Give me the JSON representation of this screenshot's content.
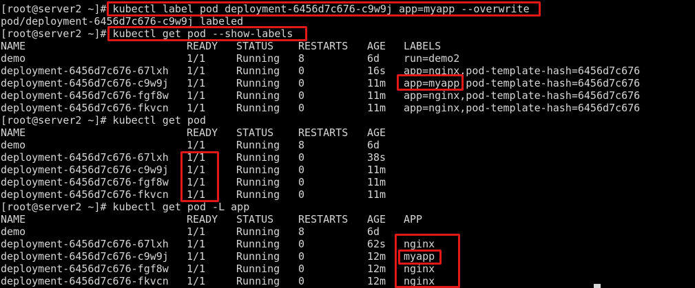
{
  "terminal": {
    "lines": [
      {
        "kind": "text",
        "text": "[root@server2 ~]# kubectl label pod deployment-6456d7c676-c9w9j app=myapp --overwrite"
      },
      {
        "kind": "text",
        "text": "pod/deployment-6456d7c676-c9w9j labeled"
      },
      {
        "kind": "text",
        "text": "[root@server2 ~]# kubectl get pod --show-labels"
      },
      {
        "kind": "row",
        "cells": [
          "NAME",
          "READY",
          "STATUS",
          "RESTARTS",
          "AGE",
          "LABELS"
        ]
      },
      {
        "kind": "row",
        "cells": [
          "demo",
          "1/1",
          "Running",
          "8",
          "6d",
          "run=demo2"
        ]
      },
      {
        "kind": "row",
        "cells": [
          "deployment-6456d7c676-67lxh",
          "1/1",
          "Running",
          "0",
          "16s",
          "app=nginx,pod-template-hash=6456d7c676"
        ]
      },
      {
        "kind": "row",
        "cells": [
          "deployment-6456d7c676-c9w9j",
          "1/1",
          "Running",
          "0",
          "11m",
          "app=myapp,pod-template-hash=6456d7c676"
        ]
      },
      {
        "kind": "row",
        "cells": [
          "deployment-6456d7c676-fgf8w",
          "1/1",
          "Running",
          "0",
          "11m",
          "app=nginx,pod-template-hash=6456d7c676"
        ]
      },
      {
        "kind": "row",
        "cells": [
          "deployment-6456d7c676-fkvcn",
          "1/1",
          "Running",
          "0",
          "11m",
          "app=nginx,pod-template-hash=6456d7c676"
        ]
      },
      {
        "kind": "text",
        "text": "[root@server2 ~]# kubectl get pod"
      },
      {
        "kind": "row",
        "cells": [
          "NAME",
          "READY",
          "STATUS",
          "RESTARTS",
          "AGE",
          ""
        ]
      },
      {
        "kind": "row",
        "cells": [
          "demo",
          "1/1",
          "Running",
          "8",
          "6d",
          ""
        ]
      },
      {
        "kind": "row",
        "cells": [
          "deployment-6456d7c676-67lxh",
          "1/1",
          "Running",
          "0",
          "38s",
          ""
        ]
      },
      {
        "kind": "row",
        "cells": [
          "deployment-6456d7c676-c9w9j",
          "1/1",
          "Running",
          "0",
          "11m",
          ""
        ]
      },
      {
        "kind": "row",
        "cells": [
          "deployment-6456d7c676-fgf8w",
          "1/1",
          "Running",
          "0",
          "11m",
          ""
        ]
      },
      {
        "kind": "row",
        "cells": [
          "deployment-6456d7c676-fkvcn",
          "1/1",
          "Running",
          "0",
          "11m",
          ""
        ]
      },
      {
        "kind": "text",
        "text": "[root@server2 ~]# kubectl get pod -L app"
      },
      {
        "kind": "row",
        "cells": [
          "NAME",
          "READY",
          "STATUS",
          "RESTARTS",
          "AGE",
          "APP"
        ]
      },
      {
        "kind": "row",
        "cells": [
          "demo",
          "1/1",
          "Running",
          "8",
          "6d",
          ""
        ]
      },
      {
        "kind": "row",
        "cells": [
          "deployment-6456d7c676-67lxh",
          "1/1",
          "Running",
          "0",
          "62s",
          "nginx"
        ]
      },
      {
        "kind": "row",
        "cells": [
          "deployment-6456d7c676-c9w9j",
          "1/1",
          "Running",
          "0",
          "12m",
          "myapp"
        ]
      },
      {
        "kind": "row",
        "cells": [
          "deployment-6456d7c676-fgf8w",
          "1/1",
          "Running",
          "0",
          "12m",
          "nginx"
        ]
      },
      {
        "kind": "row",
        "cells": [
          "deployment-6456d7c676-fkvcn",
          "1/1",
          "Running",
          "0",
          "12m",
          "nginx"
        ]
      }
    ]
  },
  "colors": {
    "background": "#000000",
    "foreground": "#d6d6d6",
    "highlight_border": "#e01818"
  }
}
